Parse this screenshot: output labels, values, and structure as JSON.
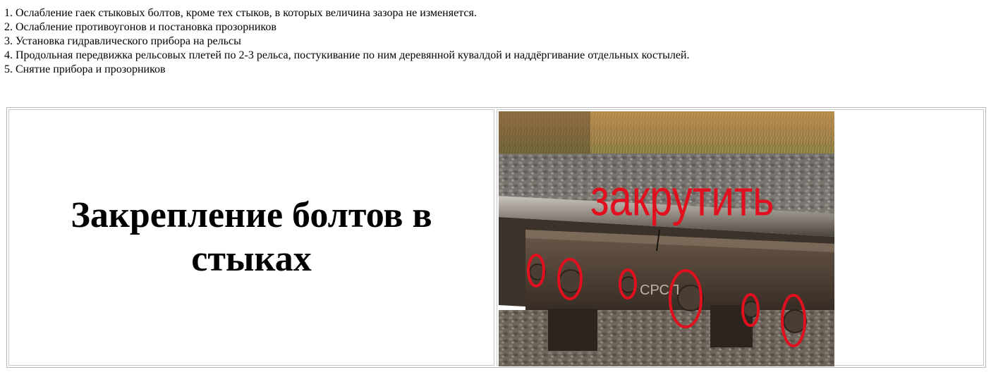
{
  "steps": [
    "1. Ослабление гаек стыковых болтов, кроме тех стыков, в которых величина зазора не изменяется.",
    "2. Ослабление противоугонов и постановка прозорников",
    "3. Установка гидравлического прибора на рельсы",
    "4. Продольная передвижка рельсовых плетей по 2-3 рельса, постукивание по ним деревянной кувалдой и наддёргивание отдельных костылей.",
    "5. Снятие прибора и прозорников"
  ],
  "section": {
    "title": "Закрепление болтов в стыках"
  },
  "photo": {
    "overlay_text": "закрутить",
    "plate_marking": "СРСП",
    "circle_color": "#e0101e"
  }
}
